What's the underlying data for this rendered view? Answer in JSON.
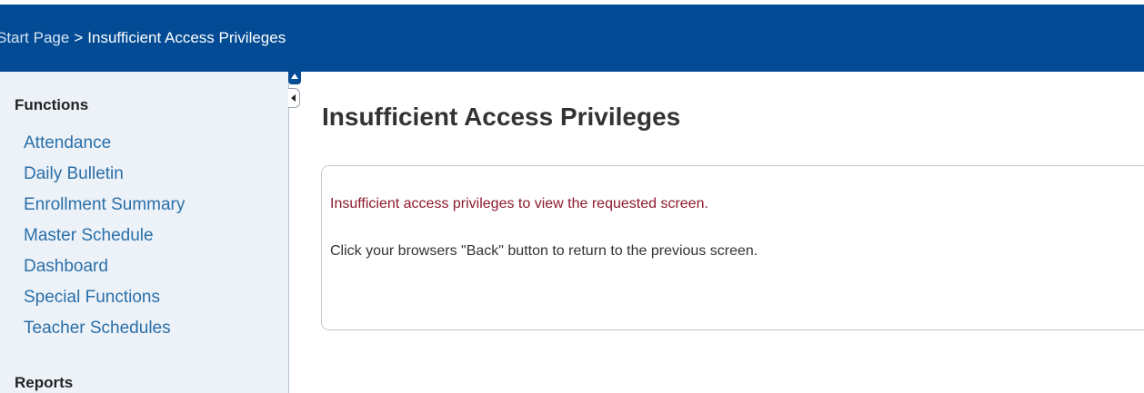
{
  "header": {
    "breadcrumb": {
      "start_link": "Start Page",
      "separator": ">",
      "current": "Insufficient Access Privileges"
    }
  },
  "sidebar": {
    "functions_heading": "Functions",
    "functions": [
      "Attendance",
      "Daily Bulletin",
      "Enrollment Summary",
      "Master Schedule",
      "Dashboard",
      "Special Functions",
      "Teacher Schedules"
    ],
    "reports_heading": "Reports"
  },
  "main": {
    "title": "Insufficient Access Privileges",
    "error_message": "Insufficient access privileges to view the requested screen.",
    "info_message": "Click your browsers \"Back\" button to return to the previous screen."
  },
  "colors": {
    "header_bg": "#034b94",
    "sidebar_bg": "#edf2f9",
    "link": "#2a6fa8",
    "error_text": "#8b1a2b"
  },
  "icons": {
    "collapse_tab": "chevron-up-icon",
    "sidebar_toggle": "chevron-left-icon"
  }
}
